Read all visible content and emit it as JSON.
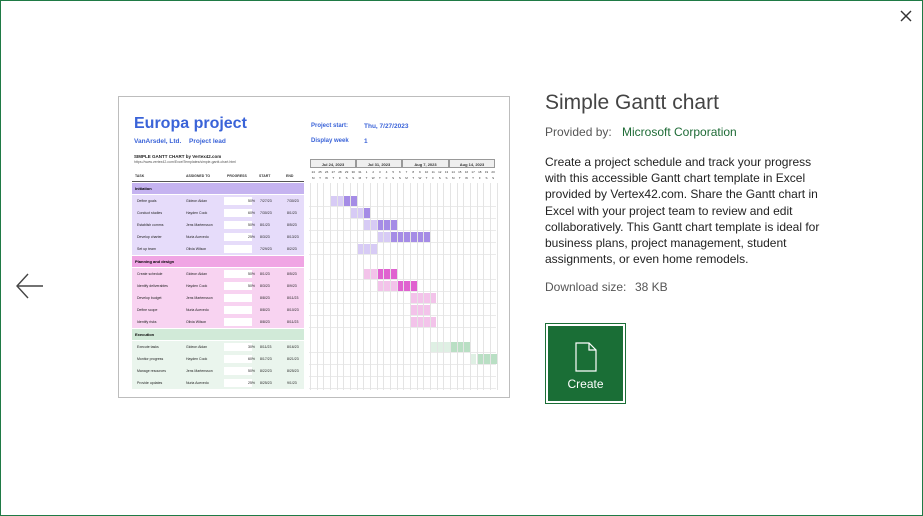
{
  "dialog": {
    "close_icon": "close-icon",
    "back_icon": "arrow-left-icon"
  },
  "template": {
    "title": "Simple Gantt chart",
    "provided_by_label": "Provided by:",
    "provider": "Microsoft Corporation",
    "description": "Create a project schedule and track your progress with this accessible Gantt chart template in Excel provided by Vertex42.com. Share the Gantt chart in Excel with your project team to review and edit collaboratively. This Gantt chart template is ideal for business plans, project management, student assignments, or even home remodels.",
    "download_size_label": "Download size:",
    "download_size": "38 KB",
    "create_label": "Create",
    "accent_color": "#1a6e36"
  },
  "preview": {
    "project_title": "Europa project",
    "company": "VanArsdel, Ltd.",
    "project_lead": "Project lead",
    "project_start_label": "Project start:",
    "project_start_value": "Thu, 7/27/2023",
    "display_week_label": "Display week",
    "display_week_value": "1",
    "subtitle": "SIMPLE GANTT CHART by Vertex42.com",
    "url": "https://www.vertex42.com/ExcelTemplates/simple-gantt-chart.html",
    "headers": [
      "TASK",
      "ASSIGNED TO",
      "PROGRESS",
      "START",
      "END"
    ],
    "weeks": [
      "Jul 24, 2023",
      "Jul 31, 2023",
      "Aug 7, 2023",
      "Aug 14, 2023"
    ],
    "day_numbers": [
      "24",
      "25",
      "26",
      "27",
      "28",
      "29",
      "30",
      "31",
      "1",
      "2",
      "3",
      "4",
      "5",
      "6",
      "7",
      "8",
      "9",
      "10",
      "11",
      "12",
      "13",
      "14",
      "15",
      "16",
      "17",
      "18",
      "19",
      "20"
    ],
    "day_letters": [
      "M",
      "T",
      "W",
      "T",
      "F",
      "S",
      "S",
      "M",
      "T",
      "W",
      "T",
      "F",
      "S",
      "S",
      "M",
      "T",
      "W",
      "T",
      "F",
      "S",
      "S",
      "M",
      "T",
      "W",
      "T",
      "F",
      "S",
      "S"
    ],
    "phases": [
      {
        "name": "Initiation",
        "header_color": "#c5b3f0",
        "row_color": "#e6dcfa",
        "bar_color": "#a58ce6",
        "bar_light": "#d7cbf5",
        "tasks": [
          {
            "task": "Define goals",
            "assigned": "Gideon Aidan",
            "progress": "50%",
            "start": "7/27/23",
            "end": "7/30/23",
            "bar_start": 3,
            "bar_len": 4,
            "done": 2
          },
          {
            "task": "Conduct studies",
            "assigned": "Hayden Cook",
            "progress": "60%",
            "start": "7/30/23",
            "end": "8/1/23",
            "bar_start": 6,
            "bar_len": 3,
            "done": 2
          },
          {
            "task": "Establish comms",
            "assigned": "Jens Martensson",
            "progress": "50%",
            "start": "8/1/23",
            "end": "8/5/23",
            "bar_start": 8,
            "bar_len": 5,
            "done": 2
          },
          {
            "task": "Develop charter",
            "assigned": "Nuria Acevedo",
            "progress": "25%",
            "start": "8/3/23",
            "end": "8/13/23",
            "bar_start": 10,
            "bar_len": 8,
            "done": 2
          },
          {
            "task": "Set up team",
            "assigned": "Olivia Wilson",
            "progress": "",
            "start": "7/29/23",
            "end": "8/2/23",
            "bar_start": 7,
            "bar_len": 3,
            "done": 3
          }
        ]
      },
      {
        "name": "Planning and design",
        "header_color": "#f0a5e4",
        "row_color": "#f8d3f1",
        "bar_color": "#e062d0",
        "bar_light": "#f3c3ea",
        "tasks": [
          {
            "task": "Create schedule",
            "assigned": "Gideon Aidan",
            "progress": "50%",
            "start": "8/1/23",
            "end": "8/5/23",
            "bar_start": 8,
            "bar_len": 5,
            "done": 2
          },
          {
            "task": "Identify deliverables",
            "assigned": "Hayden Cook",
            "progress": "50%",
            "start": "8/3/23",
            "end": "8/9/23",
            "bar_start": 10,
            "bar_len": 6,
            "done": 3
          },
          {
            "task": "Develop budget",
            "assigned": "Jens Martensson",
            "progress": "",
            "start": "8/8/23",
            "end": "8/11/23",
            "bar_start": 15,
            "bar_len": 4,
            "done": 4
          },
          {
            "task": "Define scope",
            "assigned": "Nuria Acevedo",
            "progress": "",
            "start": "8/8/23",
            "end": "8/10/23",
            "bar_start": 15,
            "bar_len": 3,
            "done": 3
          },
          {
            "task": "Identify risks",
            "assigned": "Olivia Wilson",
            "progress": "",
            "start": "8/8/23",
            "end": "8/11/23",
            "bar_start": 15,
            "bar_len": 4,
            "done": 4
          }
        ]
      },
      {
        "name": "Execution",
        "header_color": "#d1ead8",
        "row_color": "#eaf5ed",
        "bar_color": "#b9dfc4",
        "bar_light": "#dff0e4",
        "tasks": [
          {
            "task": "Execute tasks",
            "assigned": "Gideon Aidan",
            "progress": "30%",
            "start": "8/11/23",
            "end": "8/16/23",
            "bar_start": 18,
            "bar_len": 6,
            "done": 3
          },
          {
            "task": "Monitor progress",
            "assigned": "Hayden Cook",
            "progress": "60%",
            "start": "8/17/23",
            "end": "8/21/23",
            "bar_start": 24,
            "bar_len": 4,
            "done": 1
          },
          {
            "task": "Manage resources",
            "assigned": "Jens Martensson",
            "progress": "50%",
            "start": "8/22/23",
            "end": "8/25/23",
            "bar_start": 28,
            "bar_len": 0,
            "done": 0
          },
          {
            "task": "Provide updates",
            "assigned": "Nuria Acevedo",
            "progress": "25%",
            "start": "8/25/23",
            "end": "9/1/23",
            "bar_start": 28,
            "bar_len": 0,
            "done": 0
          }
        ]
      }
    ]
  }
}
